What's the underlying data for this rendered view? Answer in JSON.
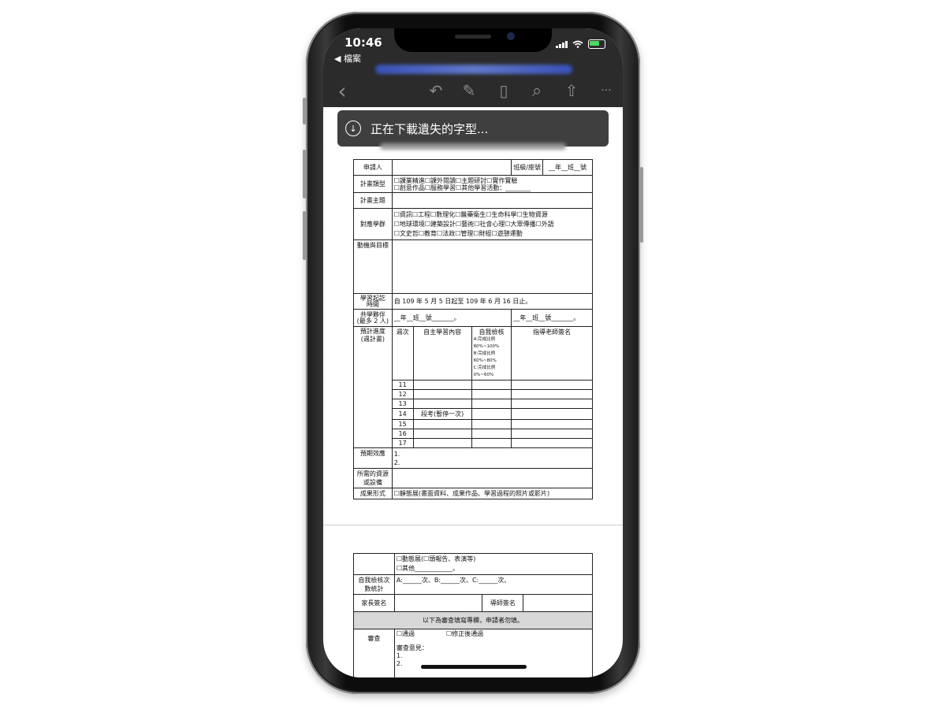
{
  "status": {
    "time": "10:46",
    "back_label": "◀ 檔案"
  },
  "toolbar": {
    "back_icon": "‹",
    "undo_icon": "↶",
    "pen_icon": "✎",
    "phone_icon": "▯",
    "search_icon": "⌕",
    "share_icon": "⇧",
    "more_icon": "···"
  },
  "toast": {
    "icon": "↓",
    "text": "正在下載遺失的字型..."
  },
  "form": {
    "applicant": "申請人",
    "class_seat": "班級/座號",
    "class_seat_value": "__年__班__號",
    "plan_type": "計畫類型",
    "plan_type_line1": "☐課業精進☐課外閱讀☐主題研討☐實作實驗",
    "plan_type_line2": "☐創意作品☐服務學習☐其他學習活動：________",
    "plan_topic": "計畫主題",
    "group": "對應學群",
    "group_line1": "☐資訊☐工程☐數理化☐醫藥衛生☐生命科學☐生物資源",
    "group_line2": "☐地球環境☐建築設計☐藝術☐社會心理☐大眾傳播☐外語",
    "group_line3": "☐文史哲☐教育☐法政☐管理☐財經☐遊憩運動",
    "motive": "動機與目標",
    "period_label1": "學習起訖",
    "period_label2": "時間",
    "period_value": "自 109 年 5 月 5 日起至 109 年 6 月 16 日止。",
    "partner_label1": "共學夥伴",
    "partner_label2": "(最多 2 人)",
    "partner1": "__年__班__號_______。",
    "partner2": "__年__班__號_______。",
    "progress_label1": "預計進度",
    "progress_label2": "(週計畫)",
    "col_week": "週次",
    "col_content": "自主學習內容",
    "col_check": "自我檢核",
    "col_sign": "指導老師簽名",
    "check_a": "A:完成比例 80%~100%",
    "check_b": "B:完成比例 60%~80%",
    "check_c": "C:完成比例 0%~60%",
    "weeks": [
      "11",
      "12",
      "13",
      "14",
      "15",
      "16",
      "17"
    ],
    "week14_content": "段考(暫停一次)",
    "effect": "預期效應",
    "effect_1": "1.",
    "effect_2": "2.",
    "resources1": "所需的資源",
    "resources2": "或設備",
    "result_form": "成果形式",
    "result_static": "☐靜態展(書面資料、成果作品、學習過程的照片或影片)"
  },
  "form2": {
    "dynamic": "☐動態展(☐頭報告、表演等)",
    "other": "☐其他____________。",
    "self_check1": "自我檢核次",
    "self_check2": "數統計",
    "self_check_value": "A:______次、B:______次、C:______次、",
    "parent_sign": "家長簽名",
    "tutor_sign": "導師簽名",
    "review_note": "以下為審查填寫專欄，申請者勿填。",
    "review": "審查",
    "pass": "☐通過",
    "pass_after": "☐修正後通過",
    "opinion": "審查意見：",
    "op1": "1.",
    "op2": "2."
  }
}
